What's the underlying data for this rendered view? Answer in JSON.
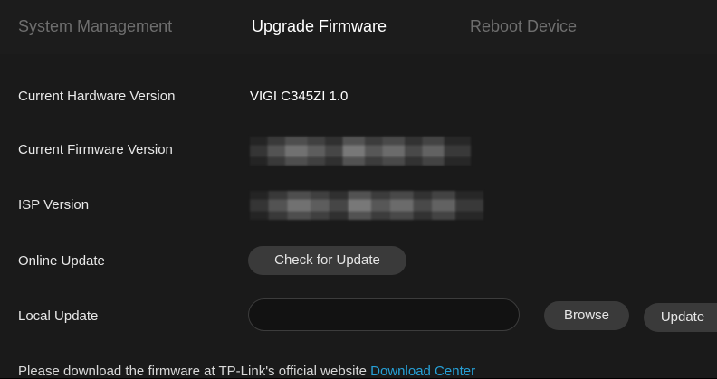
{
  "tabs": [
    {
      "label": "System Management",
      "active": false
    },
    {
      "label": "Upgrade Firmware",
      "active": true
    },
    {
      "label": "Reboot Device",
      "active": false
    }
  ],
  "rows": {
    "hardware": {
      "label": "Current Hardware Version",
      "value": "VIGI C345ZI 1.0"
    },
    "firmware": {
      "label": "Current Firmware Version"
    },
    "isp": {
      "label": "ISP Version"
    },
    "online": {
      "label": "Online Update",
      "button": "Check for Update"
    },
    "local": {
      "label": "Local Update",
      "input_value": "",
      "browse_button": "Browse",
      "update_button": "Update"
    }
  },
  "note": {
    "text": "Please download the firmware at TP-Link's official website ",
    "link": "Download Center"
  },
  "colors": {
    "accent_link": "#26a1d8",
    "background": "#1a1a1a",
    "button_bg": "#3a3a3a"
  }
}
